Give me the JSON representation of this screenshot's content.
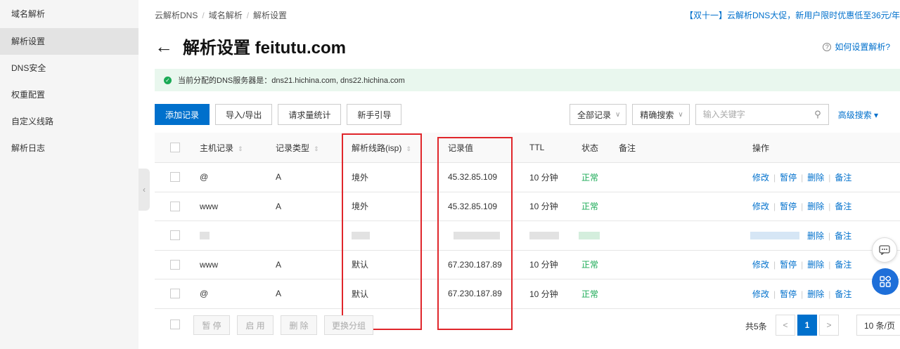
{
  "sidebar": {
    "items": [
      {
        "label": "域名解析"
      },
      {
        "label": "解析设置",
        "active": true
      },
      {
        "label": "DNS安全"
      },
      {
        "label": "权重配置"
      },
      {
        "label": "自定义线路"
      },
      {
        "label": "解析日志"
      }
    ]
  },
  "breadcrumb": [
    "云解析DNS",
    "域名解析",
    "解析设置"
  ],
  "promo": "【双十一】云解析DNS大促，新用户限时优惠低至36元/年",
  "title": "解析设置 feitutu.com",
  "help_link": "如何设置解析?",
  "dns_banner": "当前分配的DNS服务器是：dns21.hichina.com, dns22.hichina.com",
  "toolbar": {
    "add": "添加记录",
    "import": "导入/导出",
    "stats": "请求量统计",
    "guide": "新手引导"
  },
  "filters": {
    "all_records": "全部记录",
    "precise": "精确搜索",
    "search_placeholder": "输入关键字",
    "advanced": "高级搜索"
  },
  "table": {
    "headers": {
      "host": "主机记录",
      "type": "记录类型",
      "line": "解析线路(isp)",
      "value": "记录值",
      "ttl": "TTL",
      "status": "状态",
      "remark": "备注",
      "ops": "操作"
    },
    "rows": [
      {
        "host": "@",
        "type": "A",
        "line": "境外",
        "value": "45.32.85.109",
        "ttl": "10 分钟",
        "status": "正常"
      },
      {
        "host": "www",
        "type": "A",
        "line": "境外",
        "value": "45.32.85.109",
        "ttl": "10 分钟",
        "status": "正常"
      },
      {
        "host": "",
        "type": "",
        "line": "",
        "value": "",
        "ttl": "",
        "status": "",
        "blurred": true
      },
      {
        "host": "www",
        "type": "A",
        "line": "默认",
        "value": "67.230.187.89",
        "ttl": "10 分钟",
        "status": "正常"
      },
      {
        "host": "@",
        "type": "A",
        "line": "默认",
        "value": "67.230.187.89",
        "ttl": "10 分钟",
        "status": "正常"
      }
    ],
    "ops": {
      "edit": "修改",
      "pause": "暂停",
      "delete": "删除",
      "remark": "备注"
    }
  },
  "footer": {
    "pause": "暂 停",
    "enable": "启 用",
    "delete": "删 除",
    "group": "更换分组",
    "total": "共5条",
    "prev": "<",
    "current_page": "1",
    "next": ">",
    "page_size": "10 条/页"
  },
  "colors": {
    "accent": "#0070cc",
    "ok": "#1aaa55",
    "highlight": "#e0262b"
  }
}
